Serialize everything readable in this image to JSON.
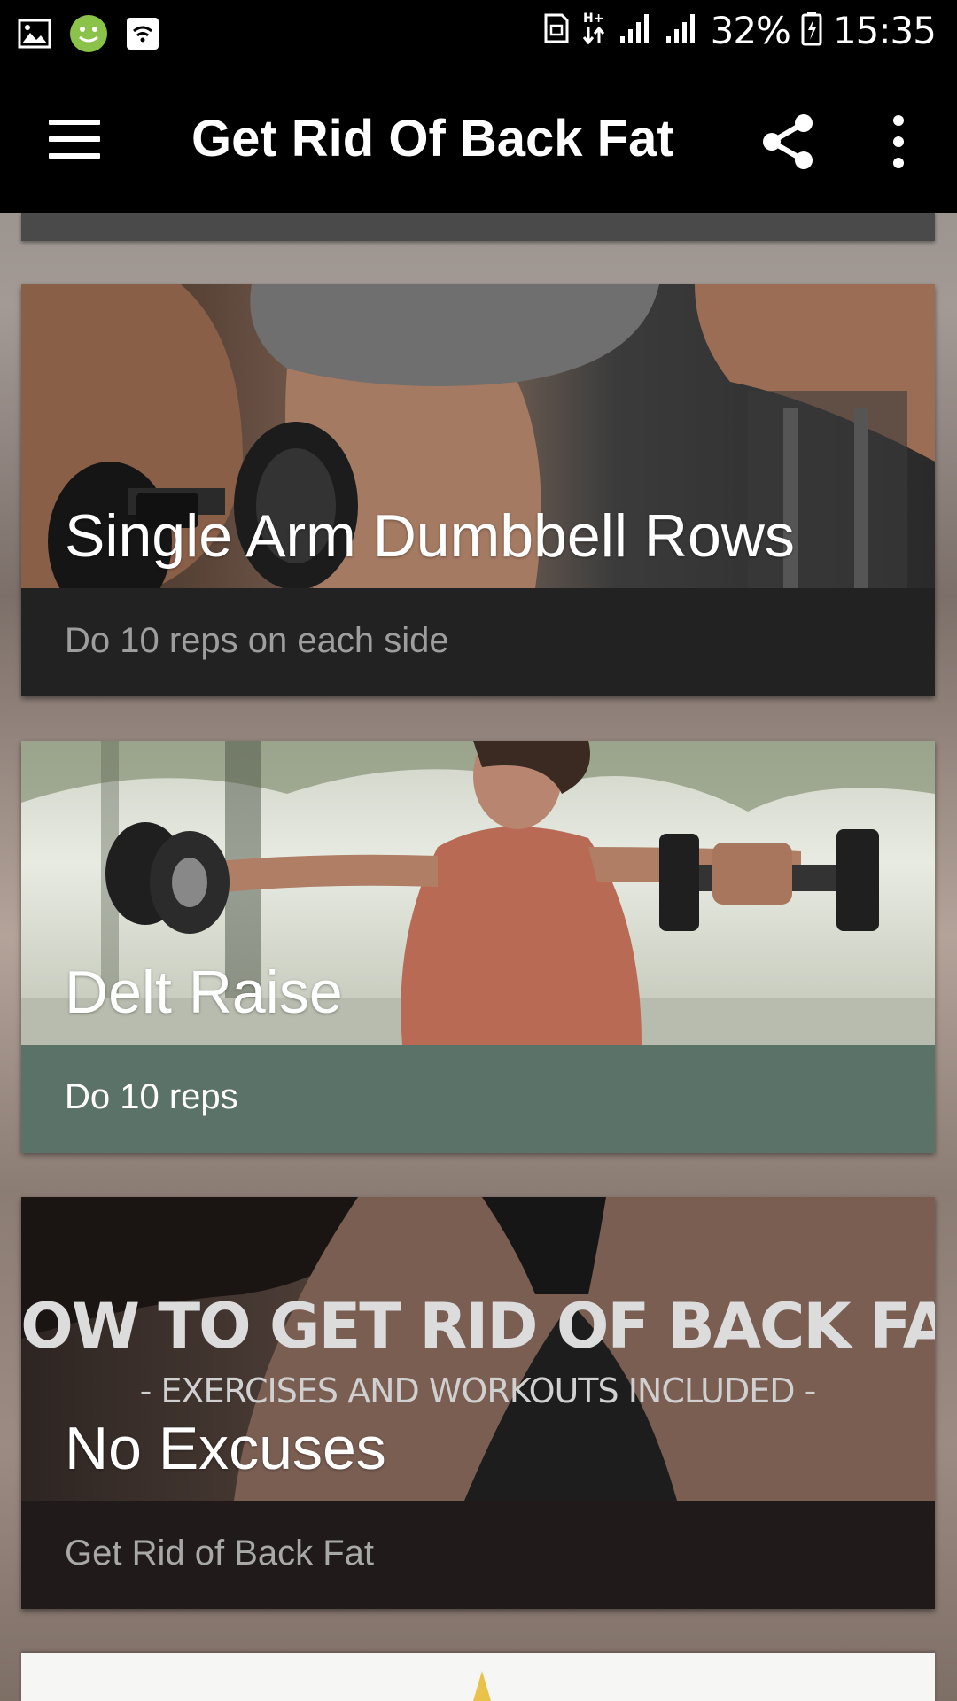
{
  "status_bar": {
    "battery_percent": "32%",
    "time": "15:35",
    "network_type": "H+",
    "icons": [
      "image-icon",
      "android-smile-icon",
      "wifi-call-icon",
      "nfc-icon",
      "data-arrows-icon",
      "signal-icon",
      "signal-icon",
      "battery-charging-icon"
    ]
  },
  "app_bar": {
    "title": "Get Rid Of Back Fat",
    "menu_icon": "hamburger-menu-icon",
    "share_icon": "share-icon",
    "more_icon": "more-vert-icon"
  },
  "cards": [
    {
      "title": "Single Arm Dumbbell Rows",
      "subtitle": "Do 10 reps on each side",
      "footer_color": "#222222",
      "subtitle_color": "#9e9e9e"
    },
    {
      "title": "Delt Raise",
      "subtitle": "Do 10 reps",
      "footer_color": "#5b7268",
      "subtitle_color": "#ffffff"
    },
    {
      "title": "No Excuses",
      "subtitle": "Get Rid of Back Fat",
      "footer_color": "#201a1b",
      "subtitle_color": "#a8a8a8",
      "image_text": {
        "headline": "HOW TO GET RID OF BACK FAT",
        "tagline": "- EXERCISES AND WORKOUTS INCLUDED -"
      }
    }
  ]
}
